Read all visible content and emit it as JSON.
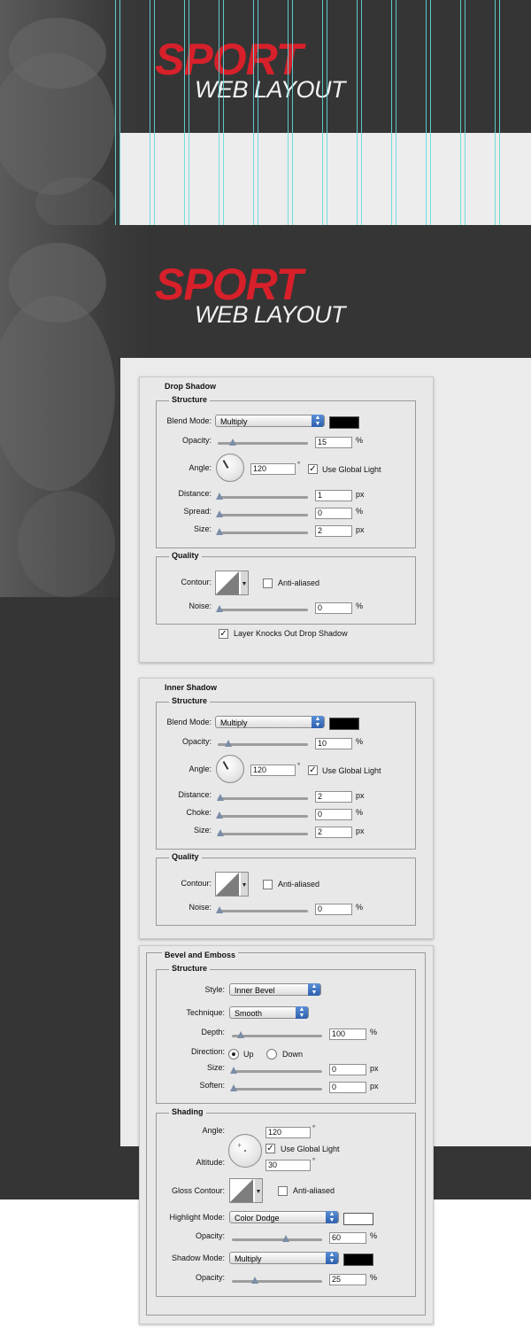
{
  "banners": [
    {
      "logo_main": "SPORT",
      "logo_sub": "WEB LAYOUT"
    },
    {
      "logo_main": "SPORT",
      "logo_sub": "WEB LAYOUT"
    }
  ],
  "drop_shadow": {
    "title": "Drop Shadow",
    "structure": "Structure",
    "blend_mode_label": "Blend Mode:",
    "blend_mode": "Multiply",
    "opacity_label": "Opacity:",
    "opacity": "15",
    "angle_label": "Angle:",
    "angle": "120",
    "use_global_light": "Use Global Light",
    "distance_label": "Distance:",
    "distance": "1",
    "spread_label": "Spread:",
    "spread": "0",
    "size_label": "Size:",
    "size": "2",
    "quality": "Quality",
    "contour_label": "Contour:",
    "anti_aliased": "Anti-aliased",
    "noise_label": "Noise:",
    "noise": "0",
    "knocks_out": "Layer Knocks Out Drop Shadow",
    "percent": "%",
    "px": "px",
    "degree": "°"
  },
  "inner_shadow": {
    "title": "Inner Shadow",
    "structure": "Structure",
    "blend_mode_label": "Blend Mode:",
    "blend_mode": "Multiply",
    "opacity_label": "Opacity:",
    "opacity": "10",
    "angle_label": "Angle:",
    "angle": "120",
    "use_global_light": "Use Global Light",
    "distance_label": "Distance:",
    "distance": "2",
    "choke_label": "Choke:",
    "choke": "0",
    "size_label": "Size:",
    "size": "2",
    "quality": "Quality",
    "contour_label": "Contour:",
    "anti_aliased": "Anti-aliased",
    "noise_label": "Noise:",
    "noise": "0",
    "percent": "%",
    "px": "px",
    "degree": "°"
  },
  "bevel": {
    "title": "Bevel and Emboss",
    "structure": "Structure",
    "style_label": "Style:",
    "style": "Inner Bevel",
    "technique_label": "Technique:",
    "technique": "Smooth",
    "depth_label": "Depth:",
    "depth": "100",
    "direction_label": "Direction:",
    "dir_up": "Up",
    "dir_down": "Down",
    "size_label": "Size:",
    "size": "0",
    "soften_label": "Soften:",
    "soften": "0",
    "shading": "Shading",
    "angle_label": "Angle:",
    "angle": "120",
    "use_global_light": "Use Global Light",
    "altitude_label": "Altitude:",
    "altitude": "30",
    "gloss_contour_label": "Gloss Contour:",
    "anti_aliased": "Anti-aliased",
    "highlight_mode_label": "Highlight Mode:",
    "highlight_mode": "Color Dodge",
    "highlight_opacity_label": "Opacity:",
    "highlight_opacity": "60",
    "shadow_mode_label": "Shadow Mode:",
    "shadow_mode": "Multiply",
    "shadow_opacity_label": "Opacity:",
    "shadow_opacity": "25",
    "percent": "%",
    "px": "px",
    "degree": "°"
  },
  "colors": {
    "brand_red": "#d7202a",
    "guide_cyan": "#63d9dc",
    "dark_bg": "#353535"
  },
  "icons": [
    "checkbox-check-icon",
    "popup-arrow-icon",
    "angle-dial-icon",
    "contour-curve-icon",
    "slider-knob-icon"
  ]
}
